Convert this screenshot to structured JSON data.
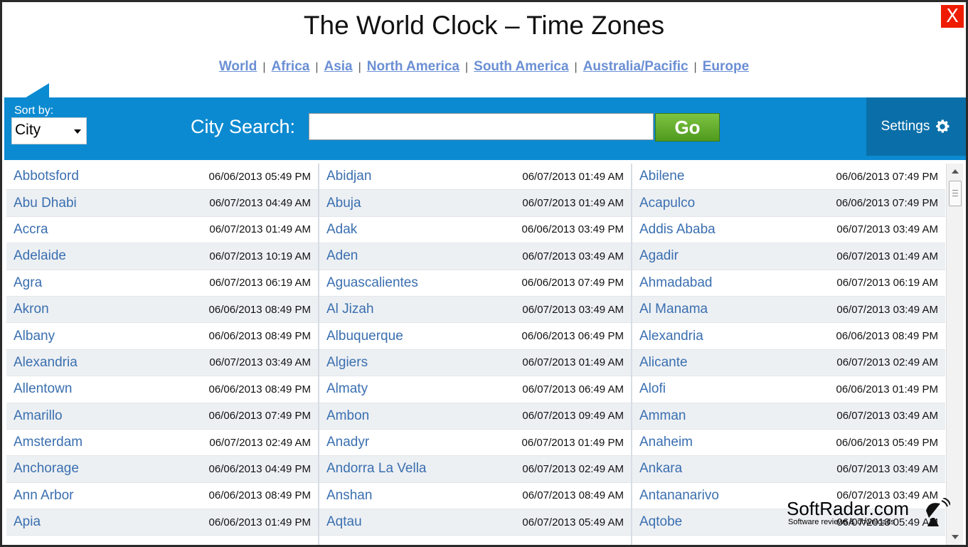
{
  "window": {
    "title": "The World Clock – Time Zones",
    "close_label": "X"
  },
  "nav": {
    "links": [
      "World",
      "Africa",
      "Asia",
      "North America",
      "South America",
      "Australia/Pacific",
      "Europe"
    ]
  },
  "toolbar": {
    "sort_label": "Sort by:",
    "sort_value": "City",
    "search_label": "City Search:",
    "search_value": "",
    "go_label": "Go",
    "settings_label": "Settings",
    "accent_color": "#0c8ad1",
    "go_color": "#5fad2a"
  },
  "columns": [
    [
      {
        "city": "Abbotsford",
        "time": "06/06/2013 05:49 PM"
      },
      {
        "city": "Abu Dhabi",
        "time": "06/07/2013 04:49 AM"
      },
      {
        "city": "Accra",
        "time": "06/07/2013 01:49 AM"
      },
      {
        "city": "Adelaide",
        "time": "06/07/2013 10:19 AM"
      },
      {
        "city": "Agra",
        "time": "06/07/2013 06:19 AM"
      },
      {
        "city": "Akron",
        "time": "06/06/2013 08:49 PM"
      },
      {
        "city": "Albany",
        "time": "06/06/2013 08:49 PM"
      },
      {
        "city": "Alexandria",
        "time": "06/07/2013 03:49 AM"
      },
      {
        "city": "Allentown",
        "time": "06/06/2013 08:49 PM"
      },
      {
        "city": "Amarillo",
        "time": "06/06/2013 07:49 PM"
      },
      {
        "city": "Amsterdam",
        "time": "06/07/2013 02:49 AM"
      },
      {
        "city": "Anchorage",
        "time": "06/06/2013 04:49 PM"
      },
      {
        "city": "Ann Arbor",
        "time": "06/06/2013 08:49 PM"
      },
      {
        "city": "Apia",
        "time": "06/06/2013 01:49 PM"
      }
    ],
    [
      {
        "city": "Abidjan",
        "time": "06/07/2013 01:49 AM"
      },
      {
        "city": "Abuja",
        "time": "06/07/2013 01:49 AM"
      },
      {
        "city": "Adak",
        "time": "06/06/2013 03:49 PM"
      },
      {
        "city": "Aden",
        "time": "06/07/2013 03:49 AM"
      },
      {
        "city": "Aguascalientes",
        "time": "06/06/2013 07:49 PM"
      },
      {
        "city": "Al Jizah",
        "time": "06/07/2013 03:49 AM"
      },
      {
        "city": "Albuquerque",
        "time": "06/06/2013 06:49 PM"
      },
      {
        "city": "Algiers",
        "time": "06/07/2013 01:49 AM"
      },
      {
        "city": "Almaty",
        "time": "06/07/2013 06:49 AM"
      },
      {
        "city": "Ambon",
        "time": "06/07/2013 09:49 AM"
      },
      {
        "city": "Anadyr",
        "time": "06/07/2013 01:49 PM"
      },
      {
        "city": "Andorra La Vella",
        "time": "06/07/2013 02:49 AM"
      },
      {
        "city": "Anshan",
        "time": "06/07/2013 08:49 AM"
      },
      {
        "city": "Aqtau",
        "time": "06/07/2013 05:49 AM"
      }
    ],
    [
      {
        "city": "Abilene",
        "time": "06/06/2013 07:49 PM"
      },
      {
        "city": "Acapulco",
        "time": "06/06/2013 07:49 PM"
      },
      {
        "city": "Addis Ababa",
        "time": "06/07/2013 03:49 AM"
      },
      {
        "city": "Agadir",
        "time": "06/07/2013 01:49 AM"
      },
      {
        "city": "Ahmadabad",
        "time": "06/07/2013 06:19 AM"
      },
      {
        "city": "Al Manama",
        "time": "06/07/2013 03:49 AM"
      },
      {
        "city": "Alexandria",
        "time": "06/06/2013 08:49 PM"
      },
      {
        "city": "Alicante",
        "time": "06/07/2013 02:49 AM"
      },
      {
        "city": "Alofi",
        "time": "06/06/2013 01:49 PM"
      },
      {
        "city": "Amman",
        "time": "06/07/2013 03:49 AM"
      },
      {
        "city": "Anaheim",
        "time": "06/06/2013 05:49 PM"
      },
      {
        "city": "Ankara",
        "time": "06/07/2013 03:49 AM"
      },
      {
        "city": "Antananarivo",
        "time": "06/07/2013 03:49 AM"
      },
      {
        "city": "Aqtobe",
        "time": "06/07/2013 05:49 AM"
      }
    ]
  ],
  "watermark": {
    "name": "SoftRadar.com",
    "tagline": "Software reviews & downloads"
  },
  "icons": {
    "close": "close-icon",
    "settings": "gear-icon",
    "dropdown": "chevron-down-icon",
    "watermark": "satellite-dish-icon"
  }
}
